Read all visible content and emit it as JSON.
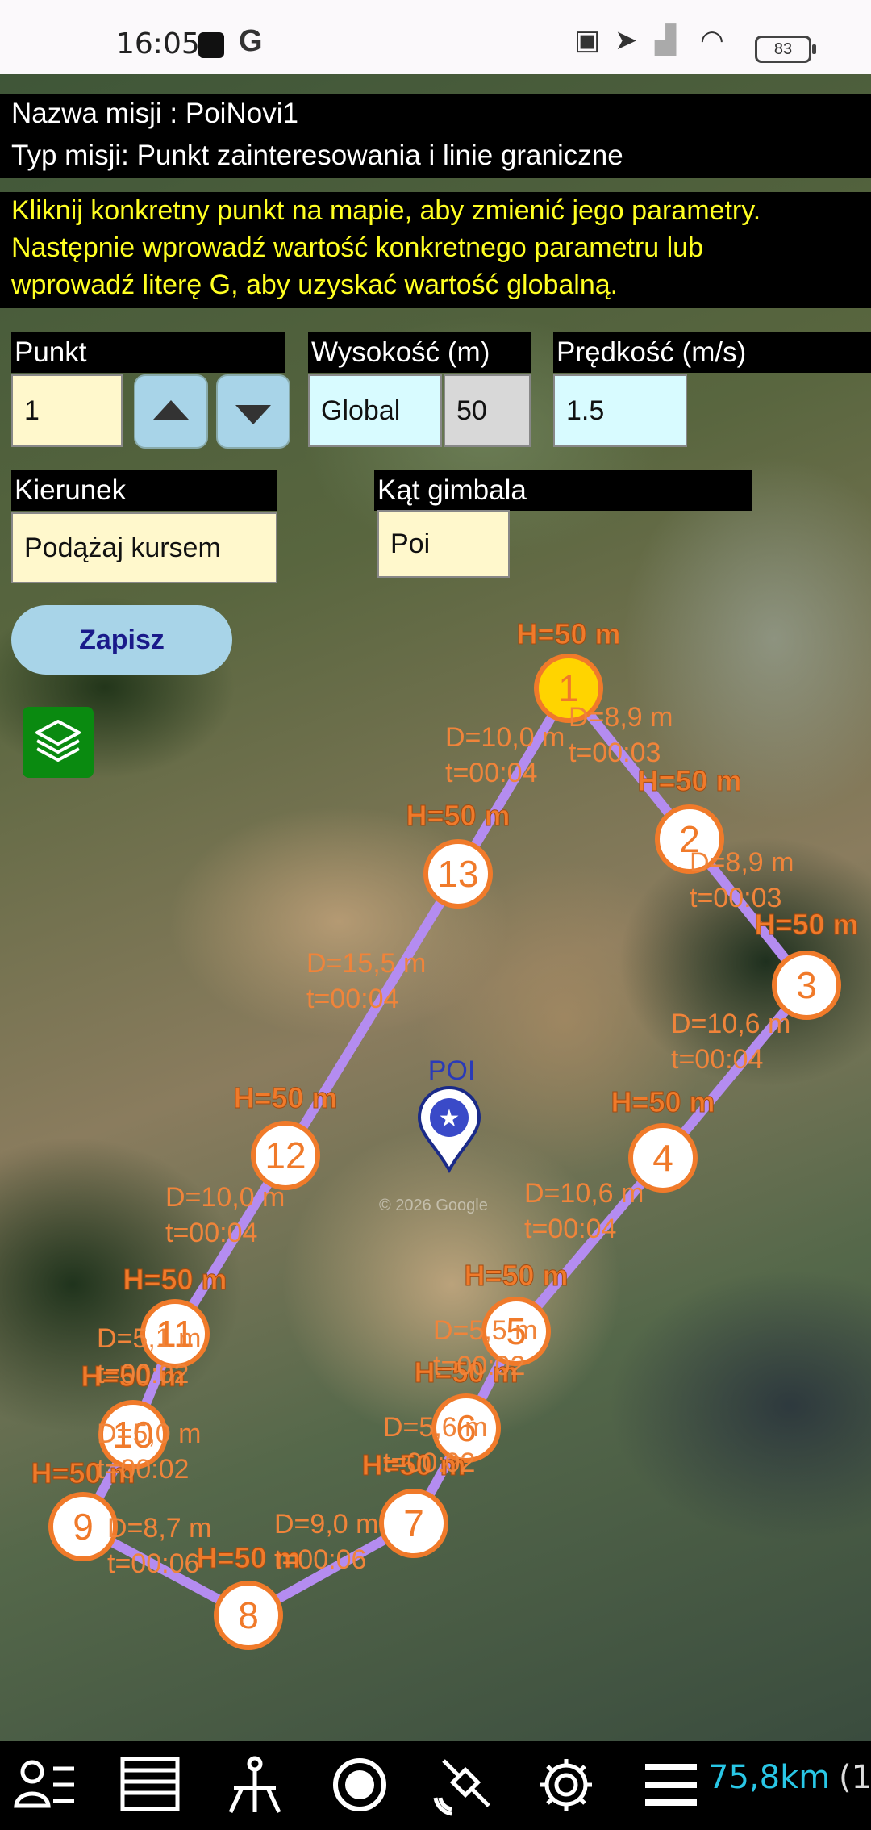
{
  "status_bar": {
    "time": "16:05",
    "g_label": "G",
    "battery": "83"
  },
  "mission": {
    "name_line": "Nazwa misji : PoiNovi1",
    "type_line": "Typ misji: Punkt zainteresowania i linie graniczne",
    "instruction_lines": [
      "Kliknij konkretny punkt na mapie, aby zmienić jego parametry.",
      "Następnie wprowadź wartość konkretnego parametru lub",
      "wprowadź literę G, aby uzyskać wartość globalną."
    ]
  },
  "form": {
    "point_label": "Punkt",
    "point_value": "1",
    "altitude_label": "Wysokość (m)",
    "altitude_mode": "Global",
    "altitude_value": "50",
    "speed_label": "Prędkość (m/s)",
    "speed_value": "1.5",
    "heading_label": "Kierunek",
    "heading_value": "Podążaj kursem",
    "gimbal_label": "Kąt gimbala",
    "gimbal_value": "Poi",
    "save_label": "Zapisz"
  },
  "map": {
    "poi_label": "POI",
    "watermark": "© 2026 Google",
    "waypoints": [
      {
        "n": "1",
        "h": "H=50 m",
        "selected": true
      },
      {
        "n": "2",
        "h": "H=50 m"
      },
      {
        "n": "3",
        "h": "H=50 m"
      },
      {
        "n": "4",
        "h": "H=50 m"
      },
      {
        "n": "5",
        "h": "H=50 m"
      },
      {
        "n": "6",
        "h": "H=50 m"
      },
      {
        "n": "7",
        "h": "H=50 m"
      },
      {
        "n": "8",
        "h": "H=50 m"
      },
      {
        "n": "9",
        "h": "H=50 m"
      },
      {
        "n": "10",
        "h": "H=50 m"
      },
      {
        "n": "11",
        "h": "H=50 m"
      },
      {
        "n": "12",
        "h": "H=50 m"
      },
      {
        "n": "13",
        "h": "H=50 m"
      }
    ],
    "segments": [
      {
        "d": "D=8,9 m",
        "t": "t=00:03"
      },
      {
        "d": "D=8,9 m",
        "t": "t=00:03"
      },
      {
        "d": "D=10,6 m",
        "t": "t=00:04"
      },
      {
        "d": "D=10,6 m",
        "t": "t=00:04"
      },
      {
        "d": "D=5,5 m",
        "t": "t=00:02"
      },
      {
        "d": "D=5,6 m",
        "t": "t=00:02"
      },
      {
        "d": "D=9,0 m",
        "t": "t=00:06"
      },
      {
        "d": "D=8,7 m",
        "t": "t=00:06"
      },
      {
        "d": "D=5,0 m",
        "t": "t=00:02"
      },
      {
        "d": "D=5,1 m",
        "t": "t=00:02"
      },
      {
        "d": "D=10,0 m",
        "t": "t=00:04"
      },
      {
        "d": "D=15,5 m",
        "t": "t=00:04"
      },
      {
        "d": "D=10,0 m",
        "t": "t=00:04"
      }
    ]
  },
  "bottom_bar": {
    "distance": "75,8km",
    "extra": "(1",
    "icons": [
      "person-list-icon",
      "table-icon",
      "drone-survey-icon",
      "record-icon",
      "satellite-icon",
      "gear-icon",
      "menu-icon"
    ]
  }
}
